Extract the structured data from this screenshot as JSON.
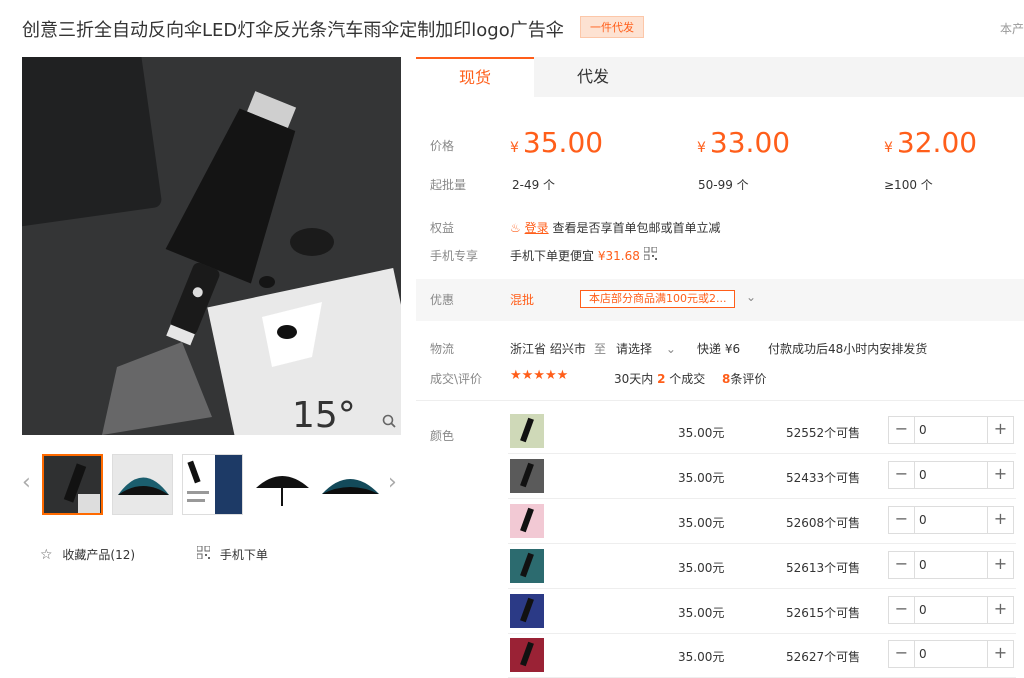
{
  "header": {
    "title": "创意三折全自动反向伞LED灯伞反光条汽车雨伞定制加印logo广告伞",
    "badge": "一件代发",
    "corner_text": "本产"
  },
  "gallery": {
    "main_image": "umbrella-led-product-photo",
    "thumbnails": [
      "thumb-1",
      "thumb-2",
      "thumb-3",
      "thumb-4",
      "thumb-5"
    ],
    "actions": {
      "favorite": "收藏产品(12)",
      "mobile_order": "手机下单"
    }
  },
  "tabs": [
    "现货",
    "代发"
  ],
  "pricing": {
    "price_label": "价格",
    "moq_label": "起批量",
    "tiers": [
      {
        "currency": "¥",
        "price": "35.00",
        "range": "2-49 个"
      },
      {
        "currency": "¥",
        "price": "33.00",
        "range": "50-99 个"
      },
      {
        "currency": "¥",
        "price": "32.00",
        "range": "≥100 个"
      }
    ]
  },
  "rights": {
    "label": "权益",
    "login": "登录",
    "text": "查看是否享首单包邮或首单立减"
  },
  "mobile": {
    "label": "手机专享",
    "text": "手机下单更便宜",
    "price": "¥31.68"
  },
  "promo": {
    "label": "优惠",
    "type": "混批",
    "coupon": "本店部分商品满100元或2..."
  },
  "logistics": {
    "label": "物流",
    "from": "浙江省 绍兴市",
    "to_word": "至",
    "select": "请选择",
    "express": "快递 ¥6",
    "delivery": "付款成功后48小时内安排发货"
  },
  "reviews": {
    "label": "成交\\评价",
    "stars": "★★★★★",
    "deals_prefix": "30天内",
    "deals_count": "2",
    "deals_suffix": "个成交",
    "review_count": "8",
    "review_suffix": "条评价"
  },
  "sku": {
    "label": "颜色",
    "rows": [
      {
        "price": "35.00元",
        "stock": "52552个可售",
        "qty": "0",
        "color": "#cfd9b8"
      },
      {
        "price": "35.00元",
        "stock": "52433个可售",
        "qty": "0",
        "color": "#5a5a5a"
      },
      {
        "price": "35.00元",
        "stock": "52608个可售",
        "qty": "0",
        "color": "#f2c9d4"
      },
      {
        "price": "35.00元",
        "stock": "52613个可售",
        "qty": "0",
        "color": "#2c6b6f"
      },
      {
        "price": "35.00元",
        "stock": "52615个可售",
        "qty": "0",
        "color": "#2b3a86"
      },
      {
        "price": "35.00元",
        "stock": "52627个可售",
        "qty": "0",
        "color": "#9a2235"
      }
    ],
    "minus": "−",
    "plus": "+"
  }
}
